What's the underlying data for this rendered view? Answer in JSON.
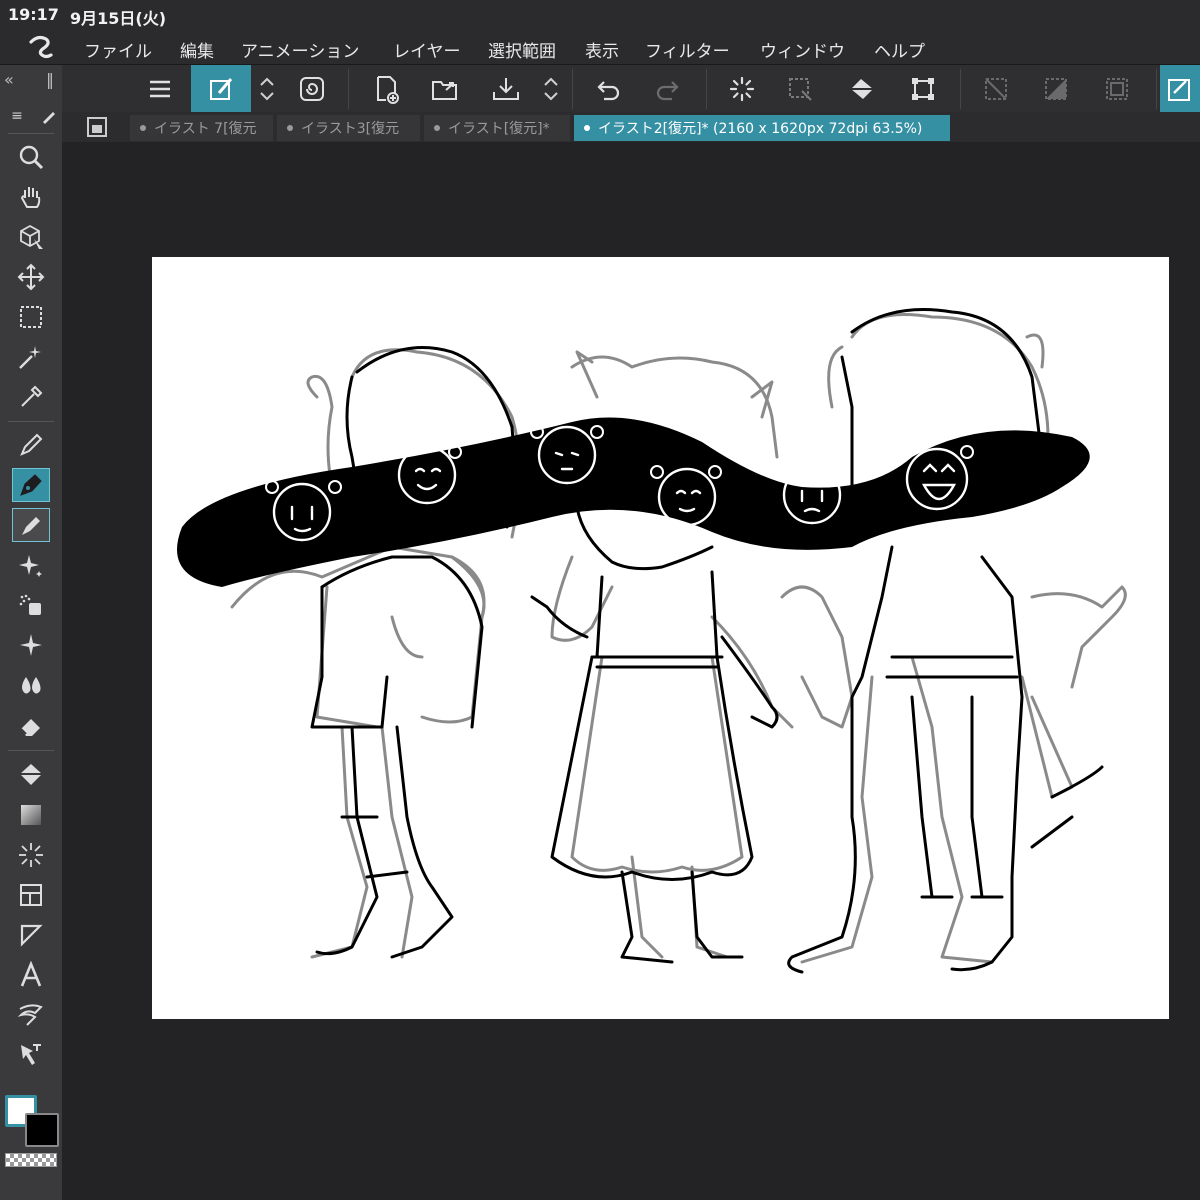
{
  "status": {
    "time": "19:17",
    "date": "9月15日(火)"
  },
  "menu": {
    "logo_icon": "clip-studio-logo-icon",
    "items": [
      "ファイル",
      "編集",
      "アニメーション",
      "レイヤー",
      "選択範囲",
      "表示",
      "フィルター",
      "ウィンドウ",
      "ヘルプ"
    ]
  },
  "command_bar": {
    "buttons": [
      "menu-icon",
      "edit-mode-icon",
      "updown-icon",
      "spiral-icon",
      "new-canvas-icon",
      "open-folder-icon",
      "save-icon",
      "updown-icon",
      "undo-icon",
      "redo-icon",
      "loading-icon",
      "select-layer-icon",
      "fill-icon",
      "transform-icon",
      "deselect-icon",
      "invert-selection-icon",
      "select-all-icon",
      "tool-property-icon"
    ]
  },
  "tabs": [
    {
      "label": "イラスト 7[復元"
    },
    {
      "label": "イラスト3[復元"
    },
    {
      "label": "イラスト[復元]*"
    },
    {
      "label": "イラスト2[復元]* (2160 x 1620px 72dpi 63.5%)"
    }
  ],
  "tools": [
    "zoom-icon",
    "hand-icon",
    "3d-object-icon",
    "move-icon",
    "rect-select-icon",
    "magic-wand-icon",
    "eyedropper-icon",
    "pencil-icon",
    "pen-icon",
    "marker-icon",
    "brush-sparkle-icon",
    "airbrush-icon",
    "decoration-icon",
    "blend-icon",
    "eraser-icon",
    "fill-bucket-icon",
    "gradient-icon",
    "figure-icon",
    "frame-icon",
    "ruler-icon",
    "text-icon",
    "balloon-icon",
    "line-fix-icon"
  ],
  "colors": {
    "main": "#ffffff",
    "sub": "#000000",
    "accent": "#3690a4"
  }
}
